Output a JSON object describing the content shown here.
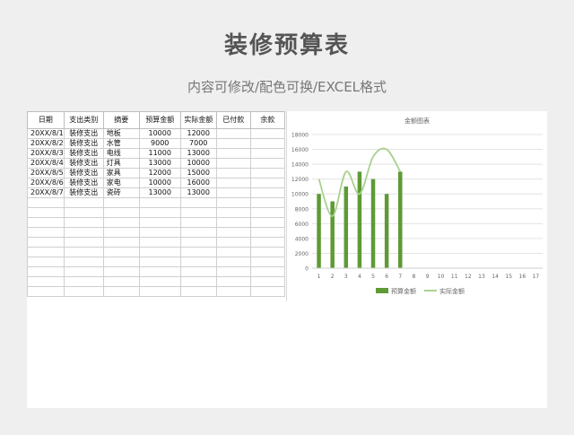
{
  "header": {
    "title": "装修预算表",
    "subtitle": "内容可修改/配色可换/EXCEL格式"
  },
  "table": {
    "columns": [
      "日期",
      "支出类别",
      "摘要",
      "预算金额",
      "实际金额",
      "已付款",
      "余款"
    ],
    "rows": [
      [
        "20XX/8/1",
        "装修支出",
        "地板",
        "10000",
        "12000",
        "",
        ""
      ],
      [
        "20XX/8/2",
        "装修支出",
        "水管",
        "9000",
        "7000",
        "",
        ""
      ],
      [
        "20XX/8/3",
        "装修支出",
        "电线",
        "11000",
        "13000",
        "",
        ""
      ],
      [
        "20XX/8/4",
        "装修支出",
        "灯具",
        "13000",
        "10000",
        "",
        ""
      ],
      [
        "20XX/8/5",
        "装修支出",
        "家具",
        "12000",
        "15000",
        "",
        ""
      ],
      [
        "20XX/8/6",
        "装修支出",
        "家电",
        "10000",
        "16000",
        "",
        ""
      ],
      [
        "20XX/8/7",
        "装修支出",
        "瓷砖",
        "13000",
        "13000",
        "",
        ""
      ]
    ],
    "empty_rows": 10
  },
  "chart_data": {
    "type": "bar",
    "title": "金额图表",
    "categories": [
      "1",
      "2",
      "3",
      "4",
      "5",
      "6",
      "7",
      "8",
      "9",
      "10",
      "11",
      "12",
      "13",
      "14",
      "15",
      "16",
      "17"
    ],
    "series": [
      {
        "name": "预算金额",
        "kind": "bar",
        "color": "#5e9a35",
        "values": [
          10000,
          9000,
          11000,
          13000,
          12000,
          10000,
          13000
        ]
      },
      {
        "name": "实际金额",
        "kind": "line",
        "color": "#a9d18e",
        "values": [
          12000,
          7000,
          13000,
          10000,
          15000,
          16000,
          13000
        ]
      }
    ],
    "ylim": [
      0,
      18000
    ],
    "yticks": [
      0,
      2000,
      4000,
      6000,
      8000,
      10000,
      12000,
      14000,
      16000,
      18000
    ],
    "grid": true,
    "legend": "bottom"
  }
}
